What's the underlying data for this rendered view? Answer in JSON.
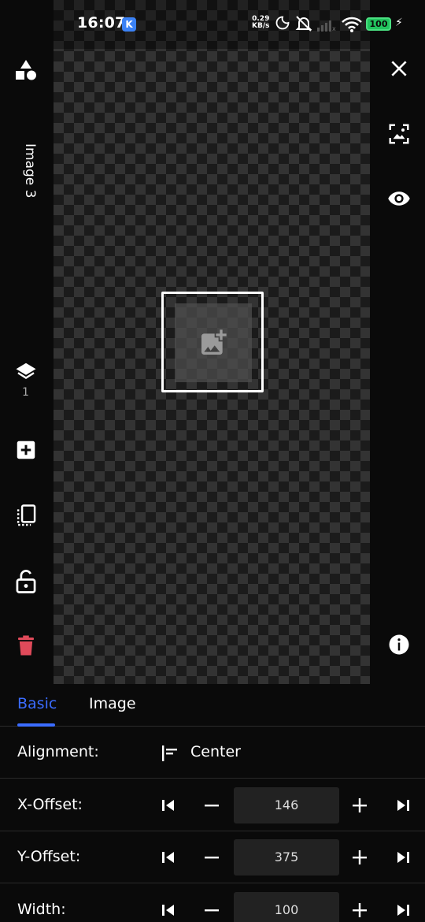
{
  "status_bar": {
    "time": "16:07",
    "app_badge": "K",
    "net_speed_value": "0.29",
    "net_speed_unit": "KB/s",
    "battery": "100"
  },
  "left_toolbar": {
    "layer_name": "Image 3",
    "layer_count": "1"
  },
  "tabs": [
    {
      "label": "Basic",
      "active": true
    },
    {
      "label": "Image",
      "active": false
    }
  ],
  "properties": {
    "alignment": {
      "label": "Alignment:",
      "value": "Center"
    },
    "x_offset": {
      "label": "X-Offset:",
      "value": "146"
    },
    "y_offset": {
      "label": "Y-Offset:",
      "value": "375"
    },
    "width": {
      "label": "Width:",
      "value": "100"
    }
  },
  "colors": {
    "accent": "#3b6cff",
    "delete": "#e04a5a",
    "battery": "#22c55e"
  }
}
